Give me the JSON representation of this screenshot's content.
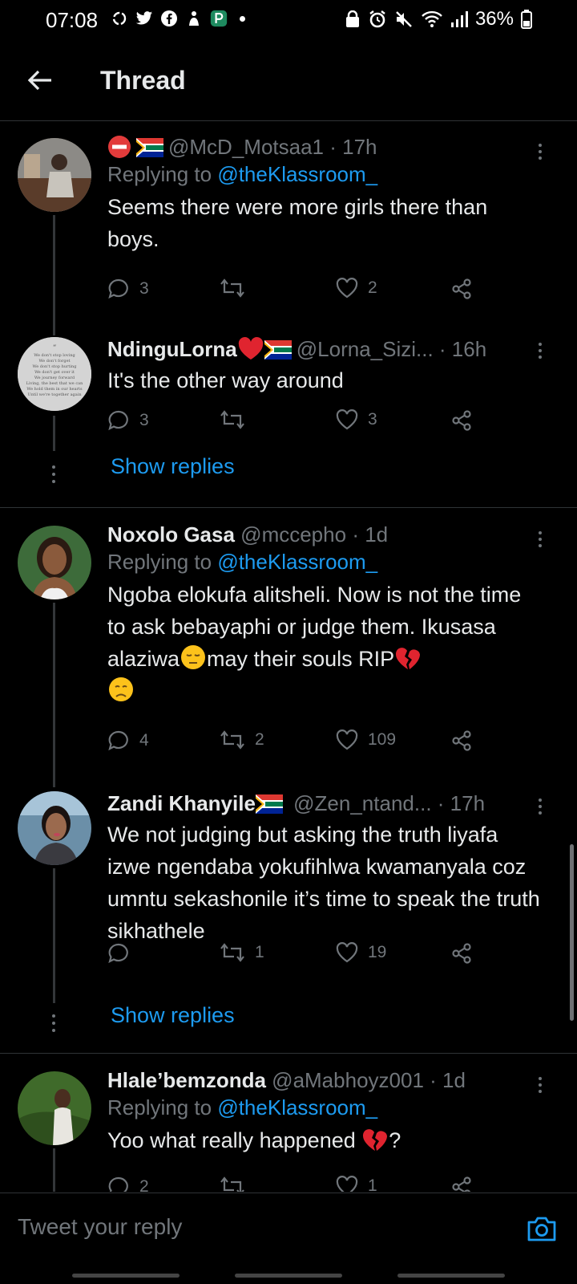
{
  "status_bar": {
    "time": "07:08",
    "battery": "36%",
    "left_icons": [
      "sync-icon",
      "twitter-icon",
      "facebook-icon",
      "hands-icon",
      "app-icon"
    ],
    "right_icons": [
      "lock-icon",
      "alarm-icon",
      "mute-icon",
      "wifi-icon",
      "signal-icon",
      "battery-icon"
    ]
  },
  "header": {
    "title": "Thread"
  },
  "tweets": [
    {
      "name": "",
      "handle": "@McD_Motsaa1",
      "time": "· 17h",
      "replying_label": "Replying to",
      "replying_to": "@theKlassroom_",
      "text": "Seems there were more girls there than boys.",
      "replies": "3",
      "retweets": "",
      "likes": "2"
    },
    {
      "name": "NdinguLorna",
      "handle": "@Lorna_Sizi...",
      "time": "· 16h",
      "text": "It's the other way around",
      "replies": "3",
      "retweets": "",
      "likes": "3",
      "show_replies": "Show replies",
      "avatar_text": "We don't stop loving\nWe don't forget\nWe don't stop hurting\nWe don't get over it\nWe journey forward\nLiving, the best that we can\nWe hold them in our hearts\nUntil we're together again"
    },
    {
      "name": "Noxolo Gasa",
      "handle": "@mccepho",
      "time": "· 1d",
      "replying_label": "Replying to",
      "replying_to": "@theKlassroom_",
      "text_a": "Ngoba elokufa alitsheli. Now is not the time to ask bebayaphi or judge them. Ikusasa alaziwa",
      "text_b": "may their souls RIP",
      "replies": "4",
      "retweets": "2",
      "likes": "109"
    },
    {
      "name": "Zandi Khanyile",
      "handle": "@Zen_ntand...",
      "time": "· 17h",
      "text": "We not judging but asking the truth liyafa izwe ngendaba yokufihlwa kwamanyala coz umntu sekashonile it’s time to speak the truth sikhathele",
      "replies": "",
      "retweets": "1",
      "likes": "19",
      "show_replies": "Show replies"
    },
    {
      "name": "Hlale’bemzonda",
      "handle": "@aMabhoyz001",
      "time": "· 1d",
      "replying_label": "Replying to",
      "replying_to": "@theKlassroom_",
      "text": "Yoo what really happened",
      "text_tail": "?",
      "replies": "2",
      "retweets": "",
      "likes": "1"
    }
  ],
  "composer": {
    "placeholder": "Tweet your reply"
  },
  "colors": {
    "accent": "#1d9bf0",
    "background": "#000000",
    "muted": "#71767b",
    "text": "#e7e9ea"
  }
}
